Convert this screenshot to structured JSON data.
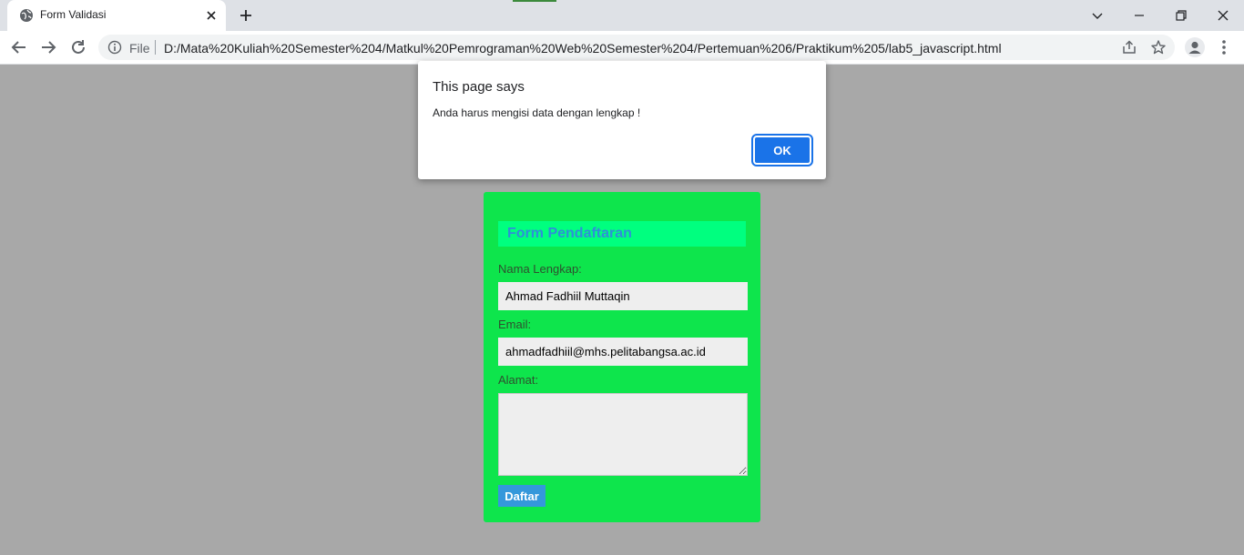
{
  "browser": {
    "tab_title": "Form Validasi",
    "url_scheme": "File",
    "url": "D:/Mata%20Kuliah%20Semester%204/Matkul%20Pemrograman%20Web%20Semester%204/Pertemuan%206/Praktikum%205/lab5_javascript.html",
    "icons": [
      "globe-icon",
      "close-icon",
      "plus-icon",
      "chevron-down-icon",
      "minimize-icon",
      "restore-icon",
      "back-icon",
      "forward-icon",
      "reload-icon",
      "info-icon",
      "share-icon",
      "star-icon",
      "profile-icon",
      "menu-icon"
    ]
  },
  "dialog": {
    "title": "This page says",
    "message": "Anda harus mengisi data dengan lengkap !",
    "ok_label": "OK"
  },
  "form": {
    "title": "Form Pendaftaran",
    "name_label": "Nama Lengkap:",
    "name_value": "Ahmad Fadhiil Muttaqin",
    "email_label": "Email:",
    "email_value": "ahmadfadhiil@mhs.pelitabangsa.ac.id",
    "address_label": "Alamat:",
    "address_value": "",
    "submit_label": "Daftar"
  },
  "colors": {
    "page_background": "#a8a8a8",
    "form_background": "#0ee54c",
    "form_header": "#00ff7f",
    "form_title": "#2f8fd8",
    "submit_button": "#3498db",
    "dialog_ok": "#1a73e8"
  }
}
